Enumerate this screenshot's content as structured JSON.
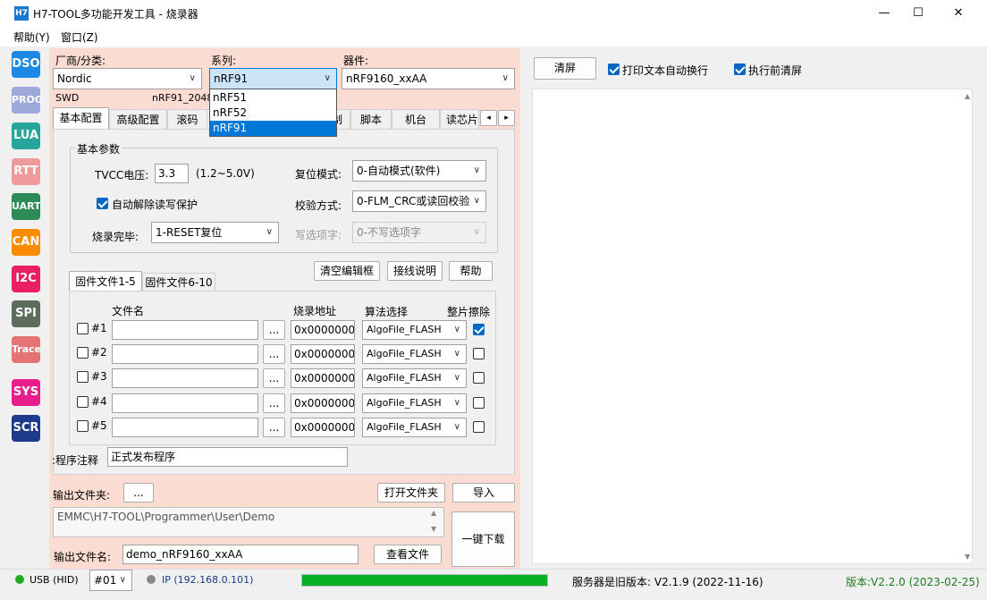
{
  "window": {
    "app_icon": "H7",
    "title": "H7-TOOL多功能开发工具 - 烧录器",
    "minimize": "—",
    "maximize": "☐",
    "close": "✕"
  },
  "menu": {
    "items": [
      "帮助(Y)",
      "窗口(Z)"
    ]
  },
  "sidebar": {
    "items": [
      {
        "label": "DSO",
        "color": "#1e88e5"
      },
      {
        "label": "PROG",
        "color": "#9fa8da"
      },
      {
        "label": "LUA",
        "color": "#26a69a"
      },
      {
        "label": "RTT",
        "color": "#ef9a9a"
      },
      {
        "label": "UART",
        "color": "#2e8b57"
      },
      {
        "label": "CAN",
        "color": "#fb8c00"
      },
      {
        "label": "I2C",
        "color": "#e91e63"
      },
      {
        "label": "SPI",
        "color": "#5d6d5d"
      },
      {
        "label": "Trace",
        "color": "#e57373"
      },
      {
        "label": "SYS",
        "color": "#e91e8c"
      },
      {
        "label": "SCR",
        "color": "#1e3a8a"
      }
    ]
  },
  "device": {
    "vendor_label": "厂商/分类:",
    "vendor_value": "Nordic",
    "series_label": "系列:",
    "series_value": "nRF91",
    "device_label": "器件:",
    "device_value": "nRF9160_xxAA",
    "interface": "SWD",
    "info": "nRF91_2048...",
    "series_options": [
      "nRF51",
      "nRF52",
      "nRF91"
    ]
  },
  "tabs": [
    "基本配置",
    "高级配置",
    "滚码",
    "",
    "",
    "制",
    "脚本",
    "机台",
    "读芯片"
  ],
  "tab_scroll": {
    "left": "◂",
    "right": "▸"
  },
  "basic": {
    "group_title": "基本参数",
    "tvcc_label": "TVCC电压:",
    "tvcc_value": "3.3",
    "tvcc_range": "(1.2~5.0V)",
    "reset_label": "复位模式:",
    "reset_value": "0-自动模式(软件)",
    "unlock_label": "自动解除读写保护",
    "verify_label": "校验方式:",
    "verify_value": "0-FLM_CRC或读回校验",
    "done_label": "烧录完毕:",
    "done_value": "1-RESET复位",
    "option_label": "写选项字:",
    "option_value": "0-不写选项字"
  },
  "file_buttons": {
    "clear": "清空编辑框",
    "wiring": "接线说明",
    "help": "帮助"
  },
  "subtabs": [
    "固件文件1-5",
    "固件文件6-10"
  ],
  "files": {
    "headers": {
      "name": "文件名",
      "addr": "烧录地址",
      "algo": "算法选择",
      "erase": "整片擦除"
    },
    "browse": "...",
    "rows": [
      {
        "id": "#1",
        "checked": false,
        "addr": "0x00000000",
        "algo": "AlgoFile_FLASH",
        "erase": true
      },
      {
        "id": "#2",
        "checked": false,
        "addr": "0x00000000",
        "algo": "AlgoFile_FLASH",
        "erase": false
      },
      {
        "id": "#3",
        "checked": false,
        "addr": "0x00000000",
        "algo": "AlgoFile_FLASH",
        "erase": false
      },
      {
        "id": "#4",
        "checked": false,
        "addr": "0x00000000",
        "algo": "AlgoFile_FLASH",
        "erase": false
      },
      {
        "id": "#5",
        "checked": false,
        "addr": "0x00000000",
        "algo": "AlgoFile_FLASH",
        "erase": false
      }
    ]
  },
  "note": {
    "label": "程序注释:",
    "value": "正式发布程序"
  },
  "output": {
    "folder_label": "输出文件夹:",
    "folder_browse": "...",
    "open_folder": "打开文件夹",
    "import": "导入",
    "path": "EMMC\\H7-TOOL\\Programmer\\User\\Demo",
    "filename_label": "输出文件名:",
    "filename_value": "demo_nRF9160_xxAA",
    "view_file": "查看文件",
    "download": "一键下载"
  },
  "console": {
    "clear": "清屏",
    "wrap_label": "打印文本自动换行",
    "wrap_checked": true,
    "preclear_label": "执行前清屏",
    "preclear_checked": true
  },
  "status": {
    "usb": "USB (HID)",
    "usb_color": "#22aa22",
    "port": "#01",
    "ip": "IP (192.168.0.101)",
    "ip_color": "#888888",
    "progress": 100,
    "server": "服务器是旧版本: V2.1.9 (2022-11-16)",
    "version": "版本:V2.2.0 (2023-02-25)",
    "version_color": "#1e7a1e"
  }
}
